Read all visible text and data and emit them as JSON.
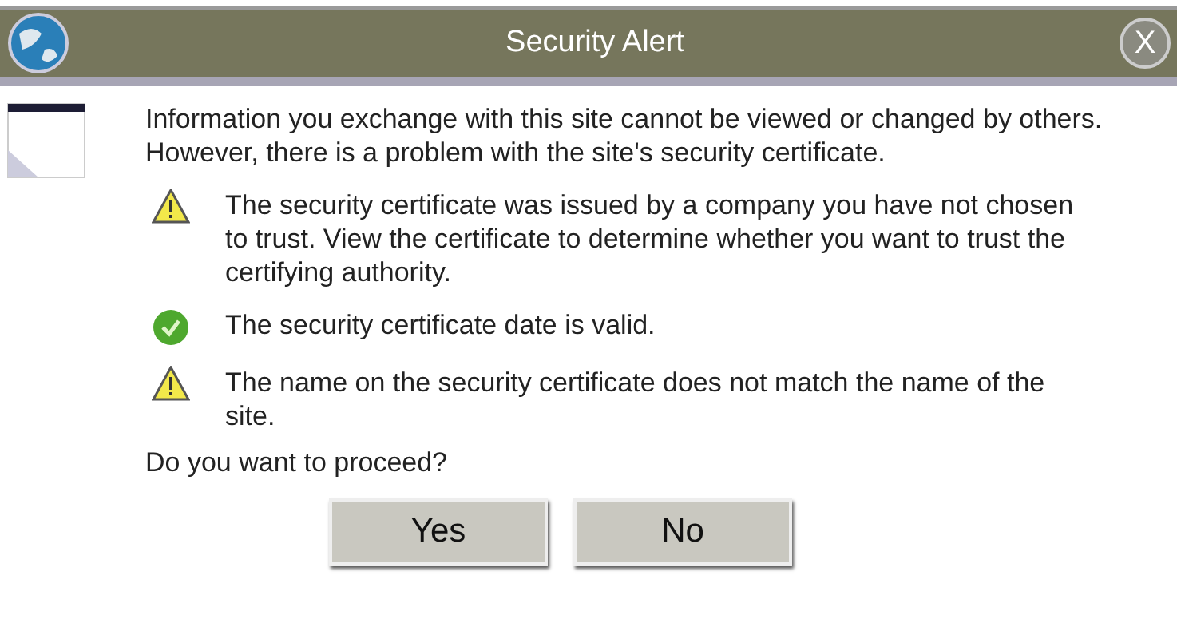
{
  "window": {
    "title": "Security Alert",
    "close": "X"
  },
  "intro": "Information you exchange with this site cannot be viewed or changed by others. However, there is a problem with the site's security certificate.",
  "items": [
    {
      "kind": "warning",
      "text": "The security certificate was issued by a company you have not chosen to trust. View the certificate to determine whether you want to trust the certifying authority."
    },
    {
      "kind": "ok",
      "text": "The security certificate date is valid."
    },
    {
      "kind": "warning",
      "text": "The name on the security certificate does not match the name of the site."
    }
  ],
  "question": "Do you want to proceed?",
  "buttons": [
    "Yes",
    "No"
  ]
}
